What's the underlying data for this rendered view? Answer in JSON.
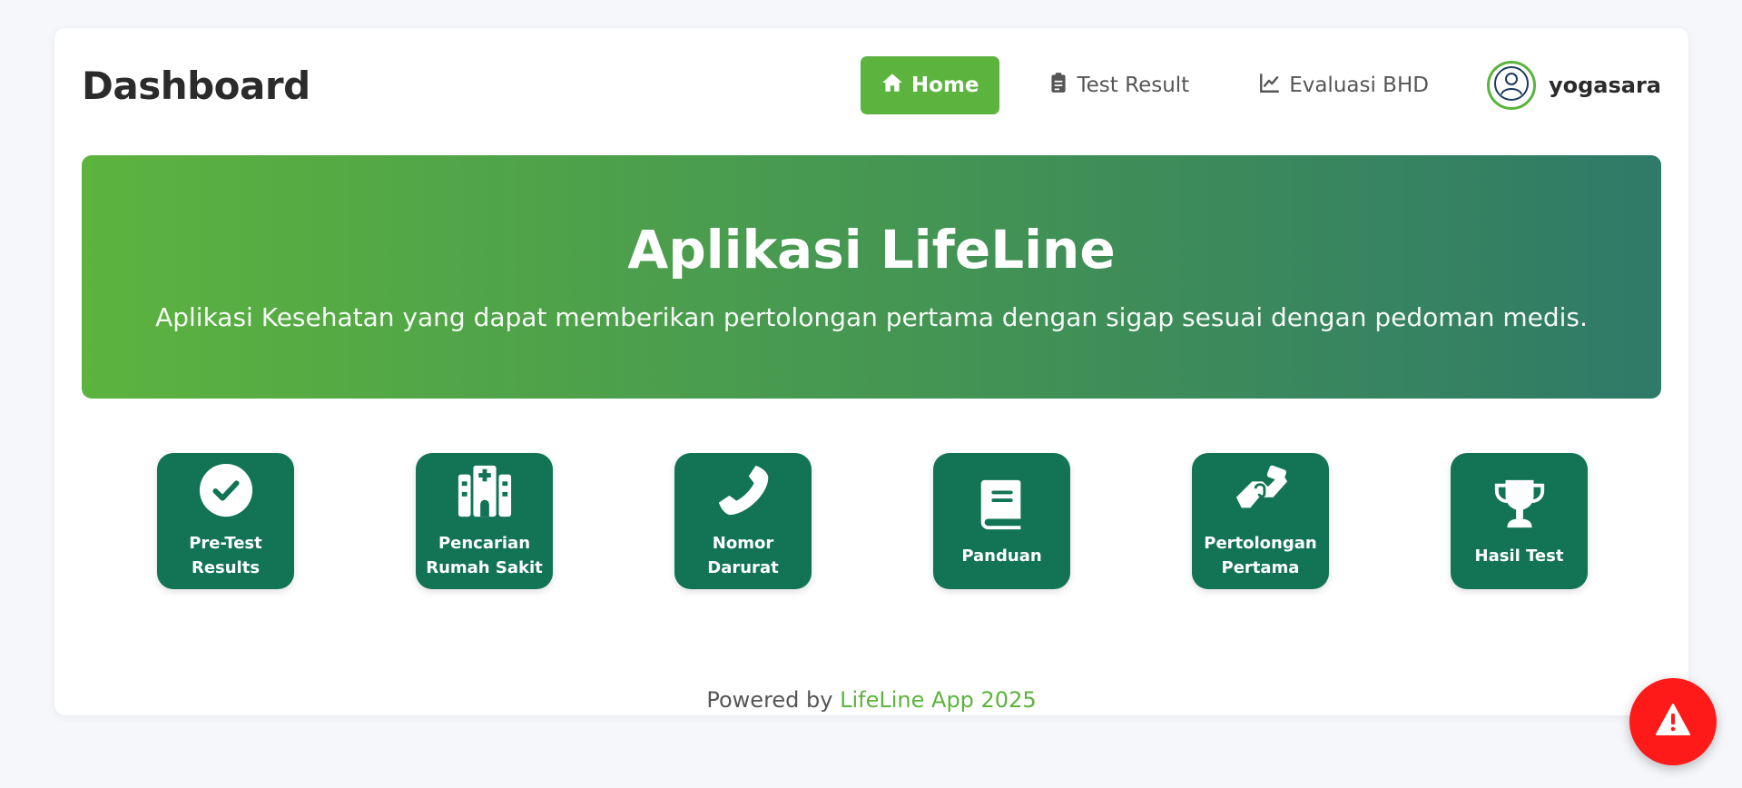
{
  "header": {
    "title": "Dashboard",
    "nav": [
      {
        "label": "Home",
        "icon": "home-icon",
        "active": true
      },
      {
        "label": "Test Result",
        "icon": "clipboard-icon"
      },
      {
        "label": "Evaluasi BHD",
        "icon": "line-chart-icon"
      }
    ],
    "user": {
      "name": "yogasara",
      "avatar_icon": "user-circle-icon"
    }
  },
  "hero": {
    "title": "Aplikasi LifeLine",
    "subtitle": "Aplikasi Kesehatan yang dapat memberikan pertolongan pertama dengan sigap sesuai dengan pedoman medis."
  },
  "tiles": [
    {
      "label": "Pre-Test\nResults",
      "icon": "check-circle-icon"
    },
    {
      "label": "Pencarian\nRumah Sakit",
      "icon": "hospital-icon"
    },
    {
      "label": "Nomor\nDarurat",
      "icon": "phone-icon"
    },
    {
      "label": "Panduan",
      "icon": "book-icon"
    },
    {
      "label": "Pertolongan\nPertama",
      "icon": "helping-hands-icon"
    },
    {
      "label": "Hasil Test",
      "icon": "trophy-icon"
    }
  ],
  "footer": {
    "prefix": "Powered by",
    "link": "LifeLine App 2025"
  },
  "fab": {
    "icon": "warning-icon"
  },
  "colors": {
    "primary_green": "#5cb33e",
    "tile_green": "#127455",
    "alert_red": "#ff1a1a",
    "gradient_end": "#2f7a68"
  }
}
